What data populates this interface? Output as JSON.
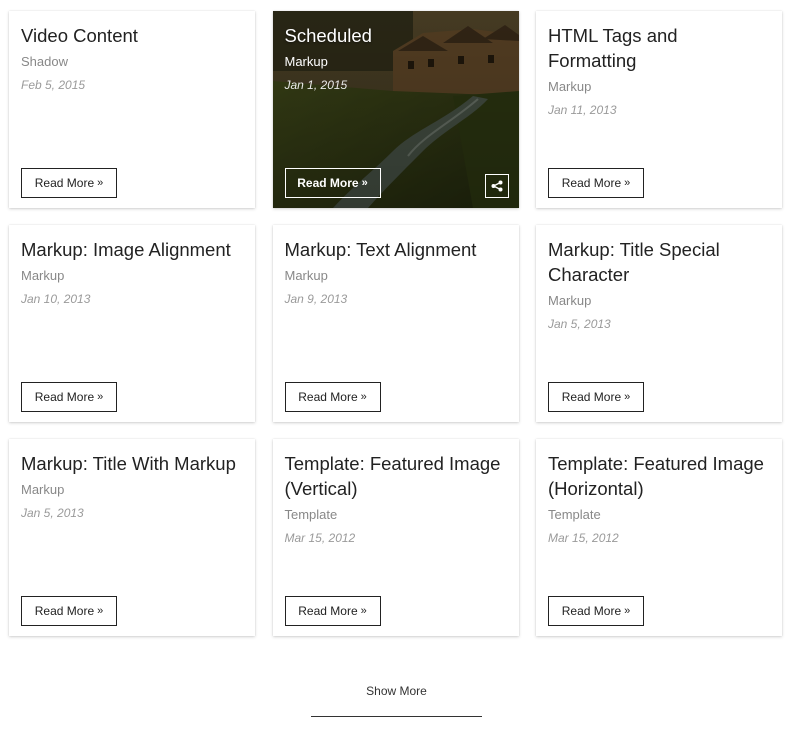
{
  "posts": [
    {
      "title": "Video Content",
      "category": "Shadow",
      "date": "Feb 5, 2015",
      "read_more": "Read More"
    },
    {
      "title": "Scheduled",
      "category": "Markup",
      "date": "Jan 1, 2015",
      "read_more": "Read More",
      "featured": true,
      "share_icon": "share-icon"
    },
    {
      "title": "HTML Tags and Formatting",
      "category": "Markup",
      "date": "Jan 11, 2013",
      "read_more": "Read More"
    },
    {
      "title": "Markup: Image Alignment",
      "category": "Markup",
      "date": "Jan 10, 2013",
      "read_more": "Read More"
    },
    {
      "title": "Markup: Text Alignment",
      "category": "Markup",
      "date": "Jan 9, 2013",
      "read_more": "Read More"
    },
    {
      "title": "Markup: Title Special Character",
      "category": "Markup",
      "date": "Jan 5, 2013",
      "read_more": "Read More"
    },
    {
      "title": "Markup: Title With Markup",
      "category": "Markup",
      "date": "Jan 5, 2013",
      "read_more": "Read More"
    },
    {
      "title": "Template: Featured Image (Vertical)",
      "category": "Template",
      "date": "Mar 15, 2012",
      "read_more": "Read More"
    },
    {
      "title": "Template: Featured Image (Horizontal)",
      "category": "Template",
      "date": "Mar 15, 2012",
      "read_more": "Read More"
    }
  ],
  "show_more": "Show More",
  "colors": {
    "text": "#222222",
    "meta": "#888888",
    "border": "#222222"
  }
}
